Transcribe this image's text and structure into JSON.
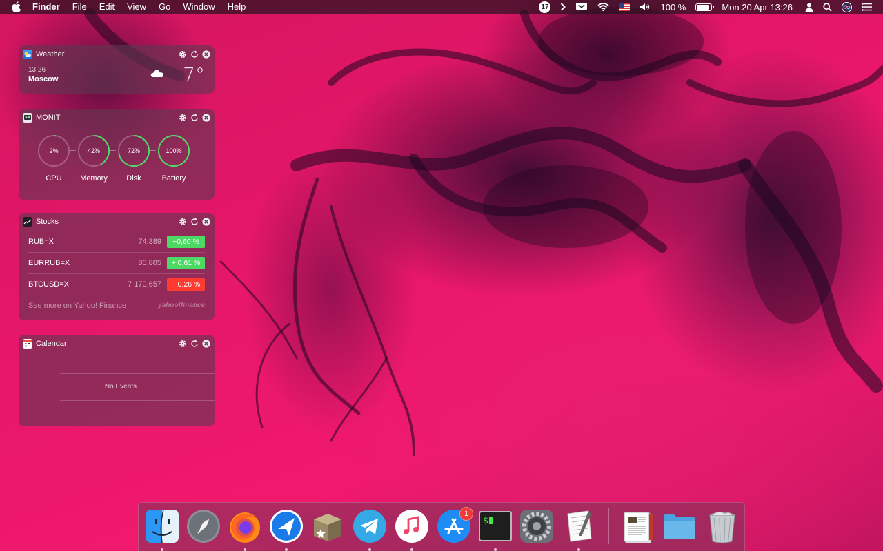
{
  "menubar": {
    "app": "Finder",
    "menus": [
      "File",
      "Edit",
      "View",
      "Go",
      "Window",
      "Help"
    ],
    "calendar_badge": "17",
    "battery": "100 %",
    "clock": "Mon 20 Apr  13:26"
  },
  "widgets": {
    "weather": {
      "title": "Weather",
      "time": "13:26",
      "city": "Moscow",
      "temp": "7°"
    },
    "monit": {
      "title": "MONIT",
      "gauges": [
        {
          "label": "CPU",
          "value": "2%",
          "level": 0.02
        },
        {
          "label": "Memory",
          "value": "42%",
          "level": 0.42
        },
        {
          "label": "Disk",
          "value": "72%",
          "level": 0.72
        },
        {
          "label": "Battery",
          "value": "100%",
          "level": 1.0
        }
      ]
    },
    "stocks": {
      "title": "Stocks",
      "rows": [
        {
          "symbol": "RUB=X",
          "price": "74,389",
          "change": "+0,60 %",
          "direction": "up"
        },
        {
          "symbol": "EURRUB=X",
          "price": "80,805",
          "change": "+ 0,61 %",
          "direction": "up"
        },
        {
          "symbol": "BTCUSD=X",
          "price": "7 170,657",
          "change": "− 0,26 %",
          "direction": "down"
        }
      ],
      "footer": "See more on Yahoo! Finance",
      "brand": "yahoo!finance"
    },
    "calendar": {
      "title": "Calendar",
      "empty": "No Events"
    }
  },
  "dock": {
    "app_store_badge": "1",
    "apps": [
      "Finder",
      "Launchpad",
      "Firefox",
      "Spark",
      "Archiver",
      "Telegram",
      "iTunes",
      "App Store",
      "Terminal",
      "System Preferences",
      "TextEdit",
      "Preview",
      "Downloads",
      "Trash"
    ]
  },
  "colors": {
    "up": "#4cd964",
    "down": "#ff3b30",
    "gauge": "#4cd964",
    "accent": "#e8176a"
  }
}
